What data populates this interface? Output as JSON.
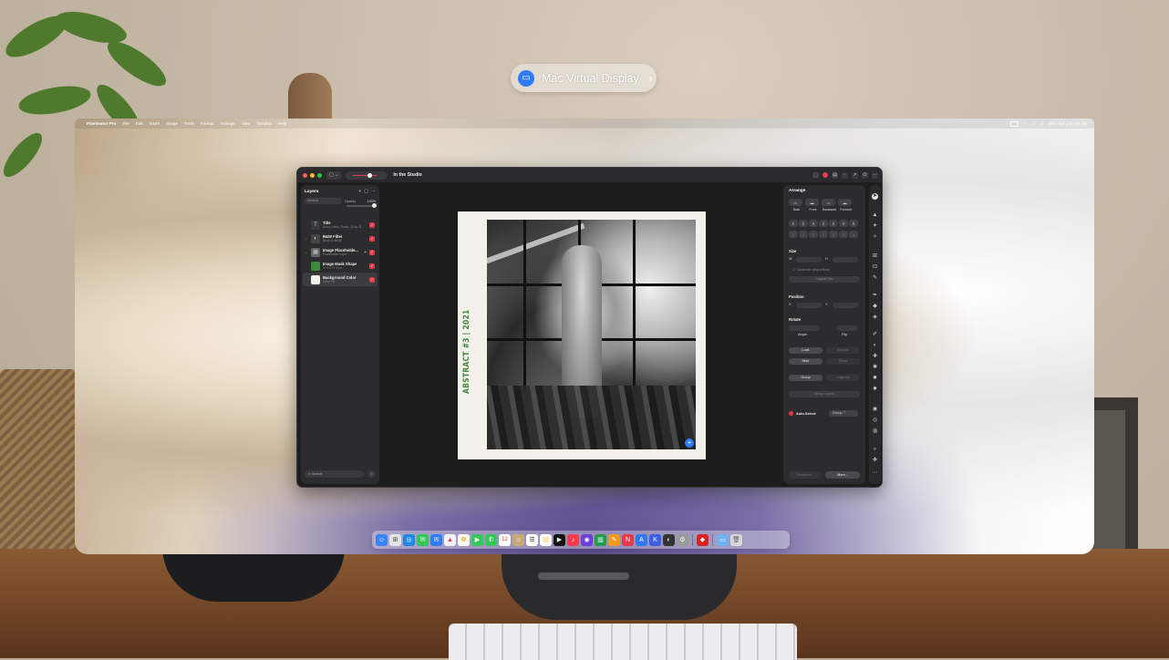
{
  "vision": {
    "pill_label": "Mac Virtual Display"
  },
  "menubar": {
    "apple": "",
    "app_name": "Pixelmator Pro",
    "items": [
      "File",
      "Edit",
      "Insert",
      "Image",
      "Tools",
      "Format",
      "Arrange",
      "View",
      "Window",
      "Help"
    ],
    "clock": "Wed Apr 1 10:00 AM"
  },
  "window": {
    "title": "In the Studio"
  },
  "layers": {
    "title": "Layers",
    "blend_mode": "Normal",
    "opacity_label": "Opacity",
    "opacity_value": "100%",
    "items": [
      {
        "name": "Title",
        "sub": "Arrow, Hess, Rodin, 16 ce. B...",
        "thumb": "T"
      },
      {
        "name": "B&W Filter",
        "sub": "Black & White",
        "thumb": "◐"
      },
      {
        "name": "Image Placeholde...",
        "sub": "Placeholder Layer",
        "thumb": "▦"
      },
      {
        "name": "Image Mask Shape",
        "sub": "97.5 × 97.5 px",
        "thumb": ""
      },
      {
        "name": "Background Color",
        "sub": "Color Fill",
        "thumb": ""
      }
    ],
    "search_placeholder": "Search"
  },
  "canvas": {
    "caption": "ABSTRACT #3 | 2021"
  },
  "arrange": {
    "title": "Arrange",
    "order_labels": [
      "Back",
      "Front",
      "Backward",
      "Forward"
    ],
    "size_title": "Size",
    "width_label": "W",
    "height_label": "H",
    "constrain_label": "Constrain proportions",
    "original_size": "Original Size",
    "position_title": "Position",
    "x_label": "X",
    "y_label": "Y",
    "rotate_title": "Rotate",
    "angle_label": "Angle",
    "flip_label": "Flip",
    "lock": "Lock",
    "unlock": "Unlock",
    "hide": "Hide",
    "show": "Show",
    "group": "Group",
    "ungroup": "Ungroup",
    "merge": "Merge Layers",
    "auto_select": "Auto-Select:",
    "auto_select_value": "Group",
    "transform": "Transform...",
    "more": "More..."
  },
  "colors": {
    "accent_red": "#e33b4b",
    "caption_green": "#3d8a3c",
    "accent_blue": "#2f7bf5"
  },
  "dock": {
    "calendar_day": "12"
  }
}
